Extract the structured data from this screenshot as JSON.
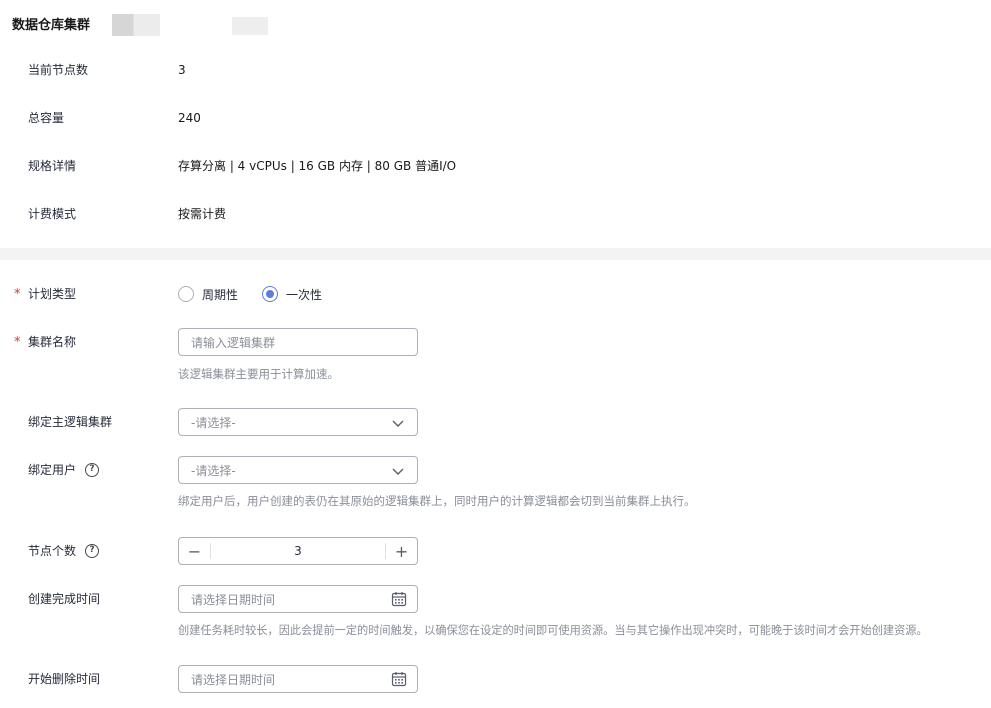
{
  "header": {
    "title": "数据仓库集群"
  },
  "info": [
    {
      "label": "当前节点数",
      "value": "3"
    },
    {
      "label": "总容量",
      "value": "240"
    },
    {
      "label": "规格详情",
      "value": "存算分离 | 4 vCPUs | 16 GB 内存 | 80 GB 普通I/O"
    },
    {
      "label": "计费模式",
      "value": "按需计费"
    }
  ],
  "form": {
    "plan_type": {
      "label": "计划类型",
      "options": [
        "周期性",
        "一次性"
      ],
      "selected": "一次性"
    },
    "cluster_name": {
      "label": "集群名称",
      "placeholder": "请输入逻辑集群",
      "hint": "该逻辑集群主要用于计算加速。"
    },
    "bind_main_cluster": {
      "label": "绑定主逻辑集群",
      "placeholder": "-请选择-"
    },
    "bind_user": {
      "label": "绑定用户",
      "placeholder": "-请选择-",
      "hint": "绑定用户后，用户创建的表仍在其原始的逻辑集群上，同时用户的计算逻辑都会切到当前集群上执行。"
    },
    "node_count": {
      "label": "节点个数",
      "value": "3",
      "minus": "−",
      "plus": "+"
    },
    "create_time": {
      "label": "创建完成时间",
      "placeholder": "请选择日期时间",
      "hint": "创建任务耗时较长，因此会提前一定的时间触发，以确保您在设定的时间即可使用资源。当与其它操作出现冲突时，可能晚于该时间才会开始创建资源。"
    },
    "delete_time": {
      "label": "开始删除时间",
      "placeholder": "请选择日期时间"
    },
    "required_mark": "*",
    "help_mark": "?"
  },
  "colors": {
    "accent": "#5e7ce0",
    "required": "#e5302f",
    "border": "#adb0b8",
    "hint": "#8a8e99"
  }
}
